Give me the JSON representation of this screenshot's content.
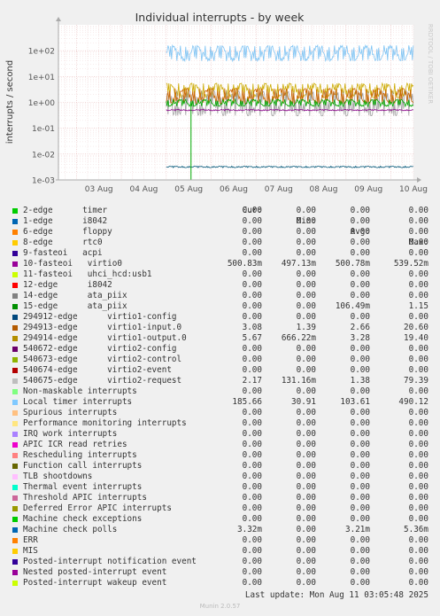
{
  "chart_data": {
    "type": "line",
    "title": "Individual interrupts - by week",
    "ylabel": "interrupts / second",
    "yscale": "log",
    "ylim": [
      0.001,
      1000
    ],
    "ytick_labels": [
      "1e+02",
      "1e+01",
      "1e+00",
      "1e-01",
      "1e-02",
      "1e-03"
    ],
    "ytick_values": [
      100,
      10,
      1,
      0.1,
      0.01,
      0.001
    ],
    "x_tick_labels": [
      "03 Aug",
      "04 Aug",
      "05 Aug",
      "06 Aug",
      "07 Aug",
      "08 Aug",
      "09 Aug",
      "10 Aug"
    ],
    "x_range_days": [
      2.6,
      10.5
    ],
    "grid": true,
    "watermark": "RRDTOOL / TOBI OETIKER",
    "series": [
      {
        "name": "Local timer interrupts",
        "color": "#7fc4f4",
        "band": [
          40,
          160
        ],
        "start_day": 5.0
      },
      {
        "name": "294914-edge virtio1-output.0",
        "color": "#ccaa00",
        "band": [
          1.5,
          5.5
        ],
        "start_day": 5.0
      },
      {
        "name": "540675-edge virtio2-request",
        "color": "#a0a0a0",
        "band": [
          0.3,
          2.8
        ],
        "start_day": 5.0
      },
      {
        "name": "294913-edge virtio1-input.0",
        "color": "#c86400",
        "band": [
          0.9,
          3.5
        ],
        "start_day": 5.0
      },
      {
        "name": "15-edge ata_piix",
        "color": "#00aa00",
        "band": [
          0.7,
          1.3
        ],
        "start_day": 5.0
      },
      {
        "name": "10-fasteoi virtio0",
        "color": "#880088",
        "band": [
          0.48,
          0.53
        ],
        "start_day": 5.0
      },
      {
        "name": "Machine check polls",
        "color": "#005577",
        "band": [
          0.003,
          0.0034
        ],
        "start_day": 5.0
      }
    ]
  },
  "legend": {
    "headers": {
      "cur": "Cur:",
      "min": "Min:",
      "avg": "Avg:",
      "max": "Max:"
    },
    "rows": [
      {
        "label": "2-edge      timer",
        "color": "#00cc00",
        "cur": "0.00",
        "min": "0.00",
        "avg": "0.00",
        "max": "0.00"
      },
      {
        "label": "1-edge      i8042",
        "color": "#0066b3",
        "cur": "0.00",
        "min": "0.00",
        "avg": "0.00",
        "max": "0.00"
      },
      {
        "label": "6-edge      floppy",
        "color": "#ff8000",
        "cur": "0.00",
        "min": "0.00",
        "avg": "0.00",
        "max": "0.00"
      },
      {
        "label": "8-edge      rtc0",
        "color": "#ffcc00",
        "cur": "0.00",
        "min": "0.00",
        "avg": "0.00",
        "max": "0.00"
      },
      {
        "label": "9-fasteoi   acpi",
        "color": "#330099",
        "cur": "0.00",
        "min": "0.00",
        "avg": "0.00",
        "max": "0.00"
      },
      {
        "label": "10-fasteoi   virtio0",
        "color": "#990099",
        "cur": "500.83m",
        "min": "497.13m",
        "avg": "500.78m",
        "max": "539.52m"
      },
      {
        "label": "11-fasteoi   uhci_hcd:usb1",
        "color": "#ccff00",
        "cur": "0.00",
        "min": "0.00",
        "avg": "0.00",
        "max": "0.00"
      },
      {
        "label": "12-edge      i8042",
        "color": "#ff0000",
        "cur": "0.00",
        "min": "0.00",
        "avg": "0.00",
        "max": "0.00"
      },
      {
        "label": "14-edge      ata_piix",
        "color": "#808080",
        "cur": "0.00",
        "min": "0.00",
        "avg": "0.00",
        "max": "0.00"
      },
      {
        "label": "15-edge      ata_piix",
        "color": "#008f00",
        "cur": "0.00",
        "min": "0.00",
        "avg": "106.49m",
        "max": "1.15"
      },
      {
        "label": "294912-edge      virtio1-config",
        "color": "#00487d",
        "cur": "0.00",
        "min": "0.00",
        "avg": "0.00",
        "max": "0.00"
      },
      {
        "label": "294913-edge      virtio1-input.0",
        "color": "#b35a00",
        "cur": "3.08",
        "min": "1.39",
        "avg": "2.66",
        "max": "20.60"
      },
      {
        "label": "294914-edge      virtio1-output.0",
        "color": "#b38f00",
        "cur": "5.67",
        "min": "666.22m",
        "avg": "3.28",
        "max": "19.40"
      },
      {
        "label": "540672-edge      virtio2-config",
        "color": "#6b006b",
        "cur": "0.00",
        "min": "0.00",
        "avg": "0.00",
        "max": "0.00"
      },
      {
        "label": "540673-edge      virtio2-control",
        "color": "#8fb300",
        "cur": "0.00",
        "min": "0.00",
        "avg": "0.00",
        "max": "0.00"
      },
      {
        "label": "540674-edge      virtio2-event",
        "color": "#b30000",
        "cur": "0.00",
        "min": "0.00",
        "avg": "0.00",
        "max": "0.00"
      },
      {
        "label": "540675-edge      virtio2-request",
        "color": "#bebebe",
        "cur": "2.17",
        "min": "131.16m",
        "avg": "1.38",
        "max": "79.39"
      },
      {
        "label": "Non-maskable interrupts",
        "color": "#80ff80",
        "cur": "0.00",
        "min": "0.00",
        "avg": "0.00",
        "max": "0.00"
      },
      {
        "label": "Local timer interrupts",
        "color": "#80c9ff",
        "cur": "185.66",
        "min": "30.91",
        "avg": "103.61",
        "max": "490.12"
      },
      {
        "label": "Spurious interrupts",
        "color": "#ffc080",
        "cur": "0.00",
        "min": "0.00",
        "avg": "0.00",
        "max": "0.00"
      },
      {
        "label": "Performance monitoring interrupts",
        "color": "#ffe680",
        "cur": "0.00",
        "min": "0.00",
        "avg": "0.00",
        "max": "0.00"
      },
      {
        "label": "IRQ work interrupts",
        "color": "#aa80ff",
        "cur": "0.00",
        "min": "0.00",
        "avg": "0.00",
        "max": "0.00"
      },
      {
        "label": "APIC ICR read retries",
        "color": "#ee00cc",
        "cur": "0.00",
        "min": "0.00",
        "avg": "0.00",
        "max": "0.00"
      },
      {
        "label": "Rescheduling interrupts",
        "color": "#ff8080",
        "cur": "0.00",
        "min": "0.00",
        "avg": "0.00",
        "max": "0.00"
      },
      {
        "label": "Function call interrupts",
        "color": "#666600",
        "cur": "0.00",
        "min": "0.00",
        "avg": "0.00",
        "max": "0.00"
      },
      {
        "label": "TLB shootdowns",
        "color": "#ffbfff",
        "cur": "0.00",
        "min": "0.00",
        "avg": "0.00",
        "max": "0.00"
      },
      {
        "label": "Thermal event interrupts",
        "color": "#00ffcc",
        "cur": "0.00",
        "min": "0.00",
        "avg": "0.00",
        "max": "0.00"
      },
      {
        "label": "Threshold APIC interrupts",
        "color": "#cc6699",
        "cur": "0.00",
        "min": "0.00",
        "avg": "0.00",
        "max": "0.00"
      },
      {
        "label": "Deferred Error APIC interrupts",
        "color": "#999900",
        "cur": "0.00",
        "min": "0.00",
        "avg": "0.00",
        "max": "0.00"
      },
      {
        "label": "Machine check exceptions",
        "color": "#00cc00",
        "cur": "0.00",
        "min": "0.00",
        "avg": "0.00",
        "max": "0.00"
      },
      {
        "label": "Machine check polls",
        "color": "#0066b3",
        "cur": "3.32m",
        "min": "0.00",
        "avg": "3.21m",
        "max": "5.36m"
      },
      {
        "label": "ERR",
        "color": "#ff8000",
        "cur": "0.00",
        "min": "0.00",
        "avg": "0.00",
        "max": "0.00"
      },
      {
        "label": "MIS",
        "color": "#ffcc00",
        "cur": "0.00",
        "min": "0.00",
        "avg": "0.00",
        "max": "0.00"
      },
      {
        "label": "Posted-interrupt notification event",
        "color": "#330099",
        "cur": "0.00",
        "min": "0.00",
        "avg": "0.00",
        "max": "0.00"
      },
      {
        "label": "Nested posted-interrupt event",
        "color": "#990099",
        "cur": "0.00",
        "min": "0.00",
        "avg": "0.00",
        "max": "0.00"
      },
      {
        "label": "Posted-interrupt wakeup event",
        "color": "#ccff00",
        "cur": "0.00",
        "min": "0.00",
        "avg": "0.00",
        "max": "0.00"
      }
    ]
  },
  "footer": {
    "last_update": "Last update: Mon Aug 11 03:05:48 2025",
    "munin_version": "Munin 2.0.57"
  }
}
